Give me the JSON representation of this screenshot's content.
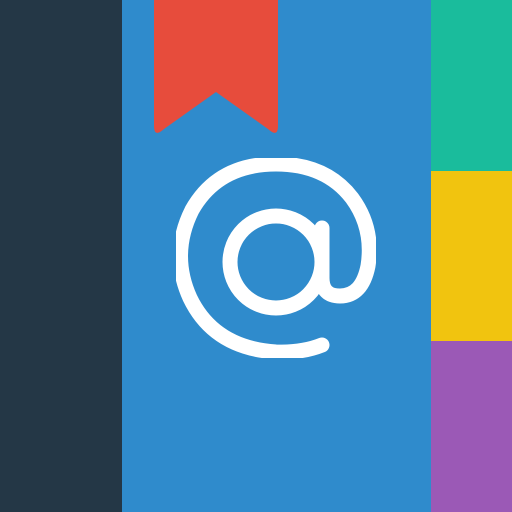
{
  "icon": {
    "spine_icon": "book-spine-icon",
    "cover_icon": "address-book-cover-icon",
    "bookmark_icon": "bookmark-ribbon-icon",
    "symbol_icon": "at-sign-icon",
    "colors": {
      "spine": "#243746",
      "cover": "#2f8bcc",
      "bookmark": "#e74c3c",
      "tab_top": "#1abc9c",
      "tab_middle": "#f1c40f",
      "tab_bottom": "#9b59b6",
      "symbol": "#ffffff"
    },
    "tabs": [
      {
        "name": "tab-teal-icon"
      },
      {
        "name": "tab-yellow-icon"
      },
      {
        "name": "tab-purple-icon"
      }
    ]
  }
}
